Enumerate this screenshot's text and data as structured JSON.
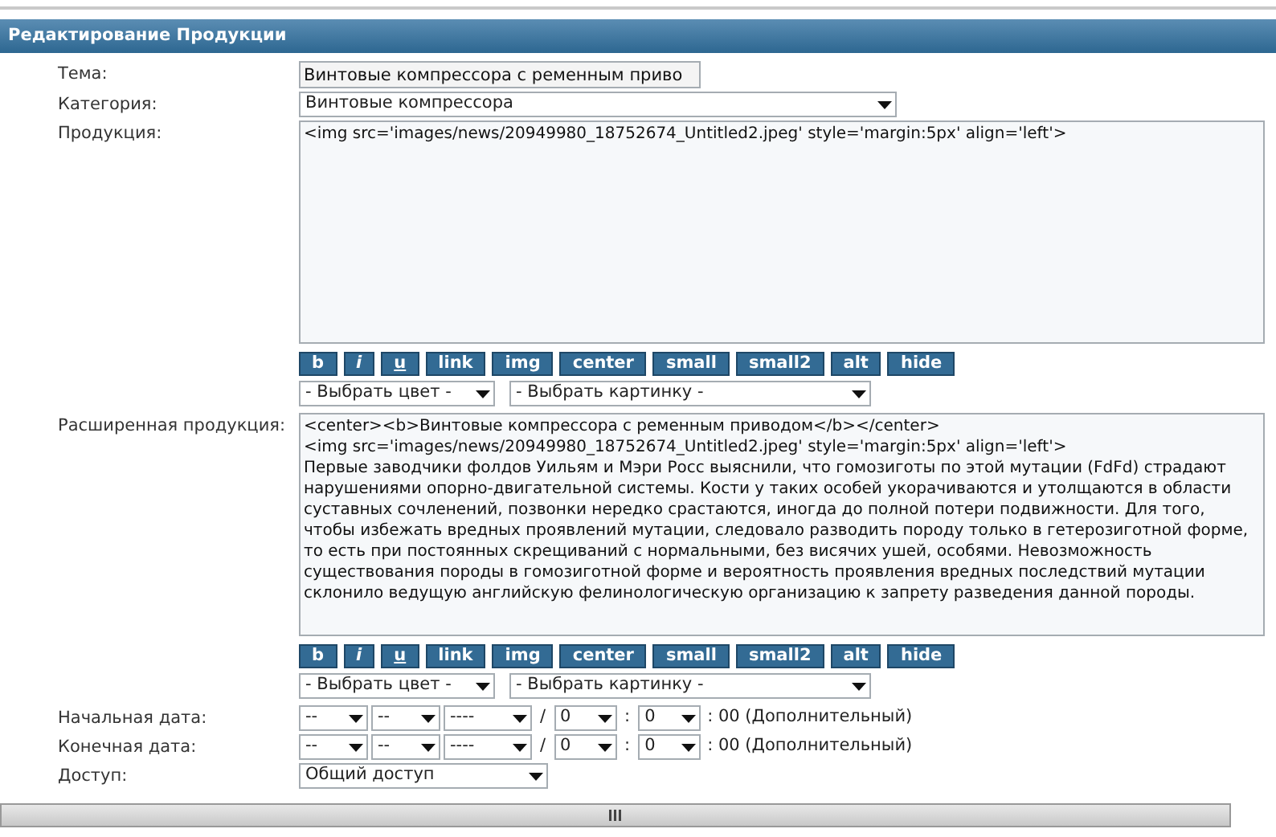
{
  "header": {
    "title": "Редактирование Продукции"
  },
  "fields": [
    {
      "kind": "text",
      "label": "Тема:",
      "value": "Винтовые компрессора с ременным приво"
    },
    {
      "kind": "select",
      "label": "Категория:",
      "value": "Винтовые компрессора"
    },
    {
      "kind": "editor",
      "label": "Продукция:",
      "value": "<img src='images/news/20949980_18752674_Untitled2.jpeg' style='margin:5px' align='left'>",
      "buttons": [
        {
          "label": "b",
          "kind": "plain"
        },
        {
          "label": "i",
          "kind": "italic"
        },
        {
          "label": "u",
          "kind": "underline"
        },
        {
          "label": "link",
          "kind": "plain"
        },
        {
          "label": "img",
          "kind": "plain"
        },
        {
          "label": "center",
          "kind": "plain"
        },
        {
          "label": "small",
          "kind": "plain"
        },
        {
          "label": "small2",
          "kind": "plain"
        },
        {
          "label": "alt",
          "kind": "plain"
        },
        {
          "label": "hide",
          "kind": "plain"
        }
      ],
      "pickers": [
        "- Выбрать цвет -",
        "- Выбрать картинку -"
      ]
    },
    {
      "kind": "editor",
      "label": "Расширенная продукция:",
      "value": "<center><b>Винтовые компрессора с ременным приводом</b></center>\n<img src='images/news/20949980_18752674_Untitled2.jpeg' style='margin:5px' align='left'>\nПервые заводчики фолдов Уильям и Мэри Росс выяснили, что гомозиготы по этой мутации (FdFd) страдают нарушениями опорно-двигательной системы. Кости у таких особей укорачиваются и утолщаются в области суставных сочленений, позвонки нередко срастаются, иногда до полной потери подвижности. Для того, чтобы избежать вредных проявлений мутации, следовало разводить породу только в гетерозиготной форме, то есть при постоянных скрещиваний с нормальными, без висячих ушей, особями. Невозможность существования породы в гомозиготной форме и вероятность проявления вредных последствий мутации склонило ведущую английскую фелинологическую организацию к запрету разведения данной породы.",
      "buttons": [
        {
          "label": "b",
          "kind": "plain"
        },
        {
          "label": "i",
          "kind": "italic"
        },
        {
          "label": "u",
          "kind": "underline"
        },
        {
          "label": "link",
          "kind": "plain"
        },
        {
          "label": "img",
          "kind": "plain"
        },
        {
          "label": "center",
          "kind": "plain"
        },
        {
          "label": "small",
          "kind": "plain"
        },
        {
          "label": "small2",
          "kind": "plain"
        },
        {
          "label": "alt",
          "kind": "plain"
        },
        {
          "label": "hide",
          "kind": "plain"
        }
      ],
      "pickers": [
        "- Выбрать цвет -",
        "- Выбрать картинку -"
      ]
    },
    {
      "kind": "date",
      "label": "Начальная дата:",
      "parts": [
        {
          "kind": "select",
          "text": "--"
        },
        {
          "kind": "select",
          "text": "--"
        },
        {
          "kind": "select",
          "text": "----"
        },
        {
          "kind": "sep",
          "text": "/"
        },
        {
          "kind": "select",
          "text": "0"
        },
        {
          "kind": "sep",
          "text": ":"
        },
        {
          "kind": "select",
          "text": "0"
        },
        {
          "kind": "note",
          "text": ": 00 (Дополнительный)"
        }
      ]
    },
    {
      "kind": "date",
      "label": "Конечная дата:",
      "parts": [
        {
          "kind": "select",
          "text": "--"
        },
        {
          "kind": "select",
          "text": "--"
        },
        {
          "kind": "select",
          "text": "----"
        },
        {
          "kind": "sep",
          "text": "/"
        },
        {
          "kind": "select",
          "text": "0"
        },
        {
          "kind": "sep",
          "text": ":"
        },
        {
          "kind": "select",
          "text": "0"
        },
        {
          "kind": "note",
          "text": ": 00 (Дополнительный)"
        }
      ]
    },
    {
      "kind": "select",
      "label": "Доступ:",
      "value": "Общий доступ"
    }
  ]
}
